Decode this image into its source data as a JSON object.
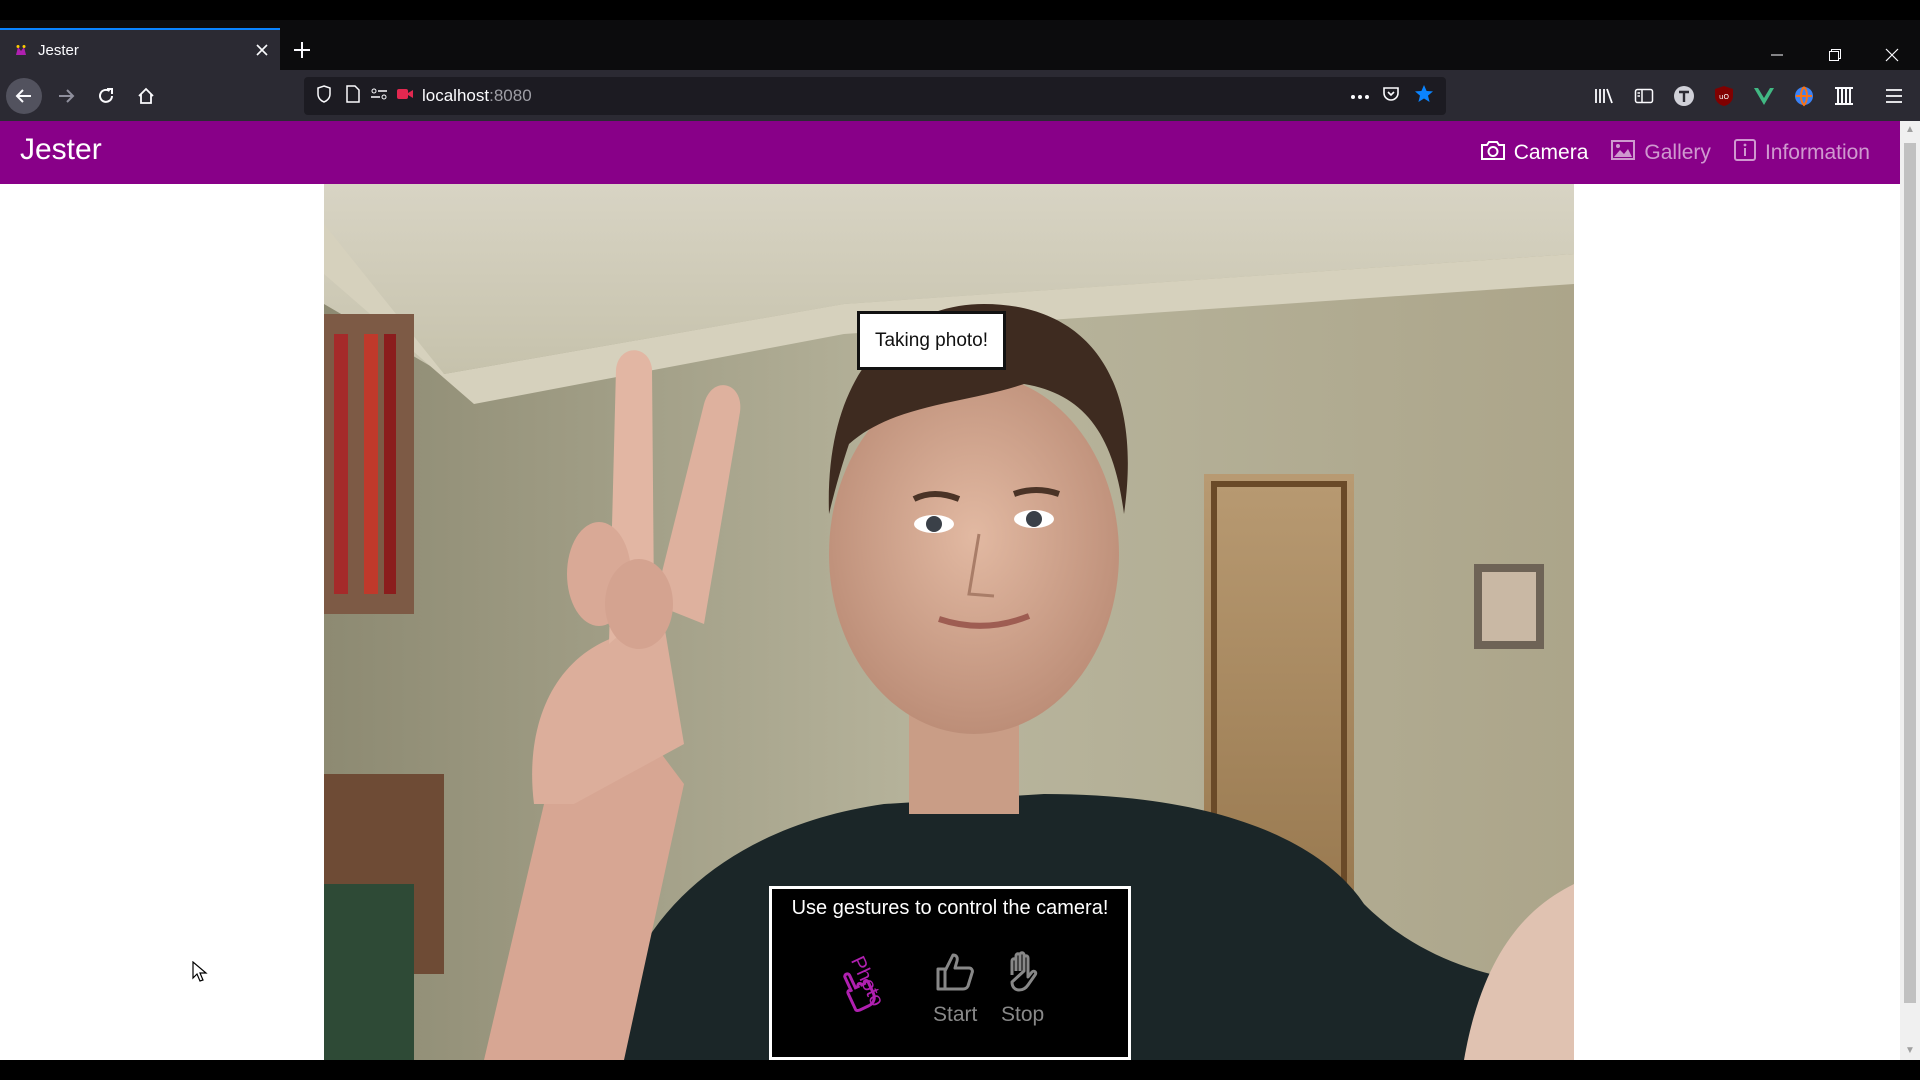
{
  "browser": {
    "tab": {
      "title": "Jester"
    },
    "url": {
      "host": "localhost",
      "port": ":8080"
    }
  },
  "app": {
    "brand": "Jester",
    "nav": [
      {
        "label": "Camera",
        "icon": "camera-icon",
        "active": true
      },
      {
        "label": "Gallery",
        "icon": "image-icon",
        "active": false
      },
      {
        "label": "Information",
        "icon": "info-icon",
        "active": false
      }
    ]
  },
  "toast": {
    "message": "Taking photo!"
  },
  "gestures": {
    "title": "Use gestures to control the camera!",
    "items": [
      {
        "label": "Photo",
        "icon": "pointing-hand-icon",
        "active": true
      },
      {
        "label": "Start",
        "icon": "thumbs-up-icon",
        "active": false
      },
      {
        "label": "Stop",
        "icon": "raised-hand-icon",
        "active": false
      }
    ]
  },
  "colors": {
    "brand": "#880088",
    "active_gesture": "#b020b0",
    "browser_accent": "#0a84ff"
  }
}
